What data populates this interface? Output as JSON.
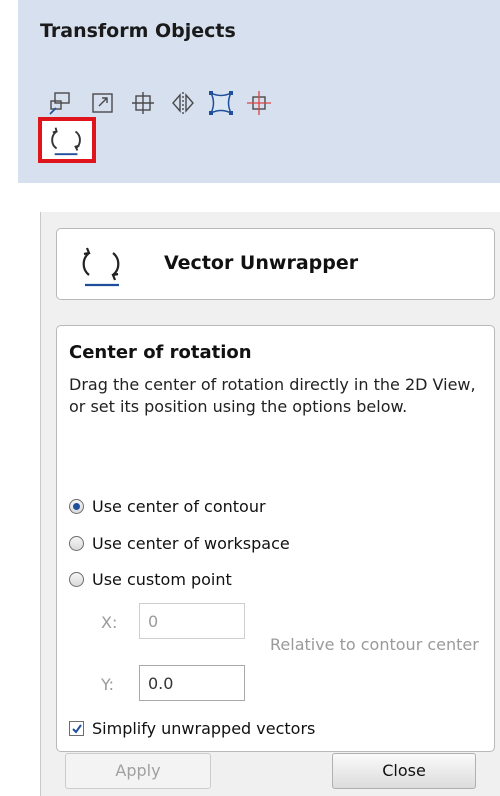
{
  "toolbar": {
    "title": "Transform Objects",
    "icons": [
      "move-icon",
      "scale-icon",
      "rotate-icon",
      "mirror-icon",
      "distort-icon",
      "align-icon",
      "vector-unwrapper-icon"
    ],
    "selected_icon": "vector-unwrapper-icon"
  },
  "dialog": {
    "title": "Vector Unwrapper",
    "section_title": "Center of rotation",
    "description": "Drag the center of rotation directly in the 2D View, or set its position using the options below.",
    "options": [
      {
        "label": "Use center of contour",
        "selected": true
      },
      {
        "label": "Use center of workspace",
        "selected": false
      },
      {
        "label": "Use custom point",
        "selected": false
      }
    ],
    "x_label": "X:",
    "x_value": "0",
    "y_label": "Y:",
    "y_value": "0.0",
    "relative_note": "Relative to contour center",
    "checkbox_label": "Simplify unwrapped vectors",
    "checkbox_checked": true,
    "apply_label": "Apply",
    "close_label": "Close"
  },
  "colors": {
    "toolbar_bg": "#d6e0ee",
    "highlight": "#e0151b",
    "accent": "#1f4f9a"
  }
}
